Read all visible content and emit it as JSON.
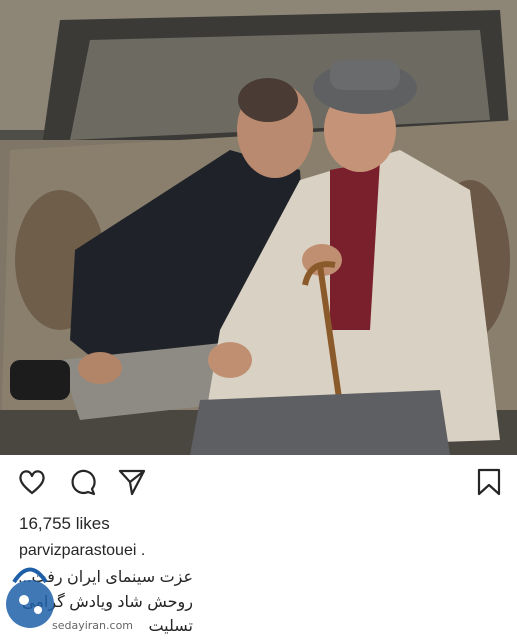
{
  "post": {
    "photo_alt": "two men sitting in front of a rusted car",
    "likes_text": "16,755 likes",
    "username": "parvizparastouei .",
    "caption_lines": [
      "عزت سینمای ایران رفت...",
      "روحش شاد ویادش گرامی",
      "تسلیت"
    ]
  },
  "icons": {
    "like": "heart-icon",
    "comment": "comment-icon",
    "share": "paper-plane-icon",
    "save": "bookmark-icon"
  },
  "watermark": {
    "logo_text": "iran",
    "site_text": "sedayiran.com"
  },
  "colors": {
    "text": "#262626",
    "icon_stroke": "#262626",
    "watermark_blue": "#1e5fa8"
  }
}
